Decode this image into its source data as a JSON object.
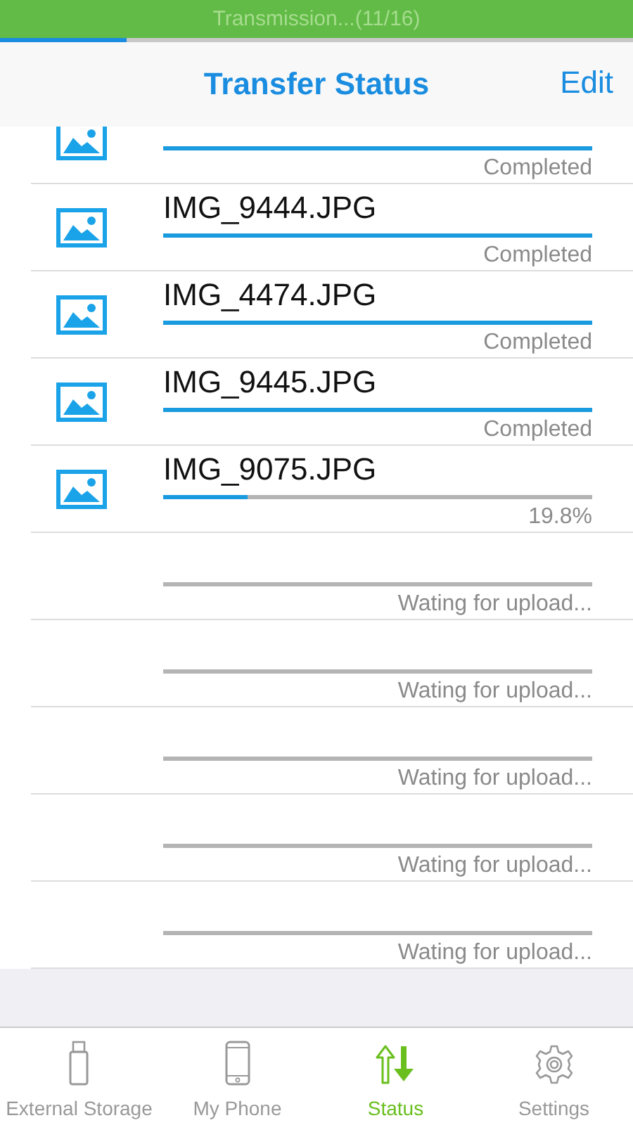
{
  "status_bar": {
    "text": "Transmission...(11/16)",
    "level": 0.2
  },
  "nav": {
    "title": "Transfer Status",
    "action": "Edit"
  },
  "rows": [
    {
      "kind": "image",
      "level": 1,
      "status": "Completed"
    },
    {
      "kind": "image",
      "name": "IMG_9444.JPG",
      "level": 1,
      "status": "Completed"
    },
    {
      "kind": "image",
      "name": "IMG_4474.JPG",
      "level": 1,
      "status": "Completed"
    },
    {
      "kind": "image",
      "name": "IMG_9445.JPG",
      "level": 1,
      "status": "Completed"
    },
    {
      "kind": "image",
      "name": "IMG_9075.JPG",
      "level": 0.198,
      "status": "19.8%"
    },
    {
      "kind": "pending",
      "status": "Wating for upload..."
    },
    {
      "kind": "pending",
      "status": "Wating for upload..."
    },
    {
      "kind": "pending",
      "status": "Wating for upload..."
    },
    {
      "kind": "pending",
      "status": "Wating for upload..."
    },
    {
      "kind": "pending",
      "status": "Wating for upload..."
    }
  ],
  "tabs": [
    {
      "kind": "storage",
      "label": "External Storage",
      "selected": false
    },
    {
      "kind": "phone",
      "label": "My Phone",
      "selected": false
    },
    {
      "kind": "transfer",
      "label": "Status",
      "selected": true
    },
    {
      "kind": "settings",
      "label": "Settings",
      "selected": false
    }
  ]
}
